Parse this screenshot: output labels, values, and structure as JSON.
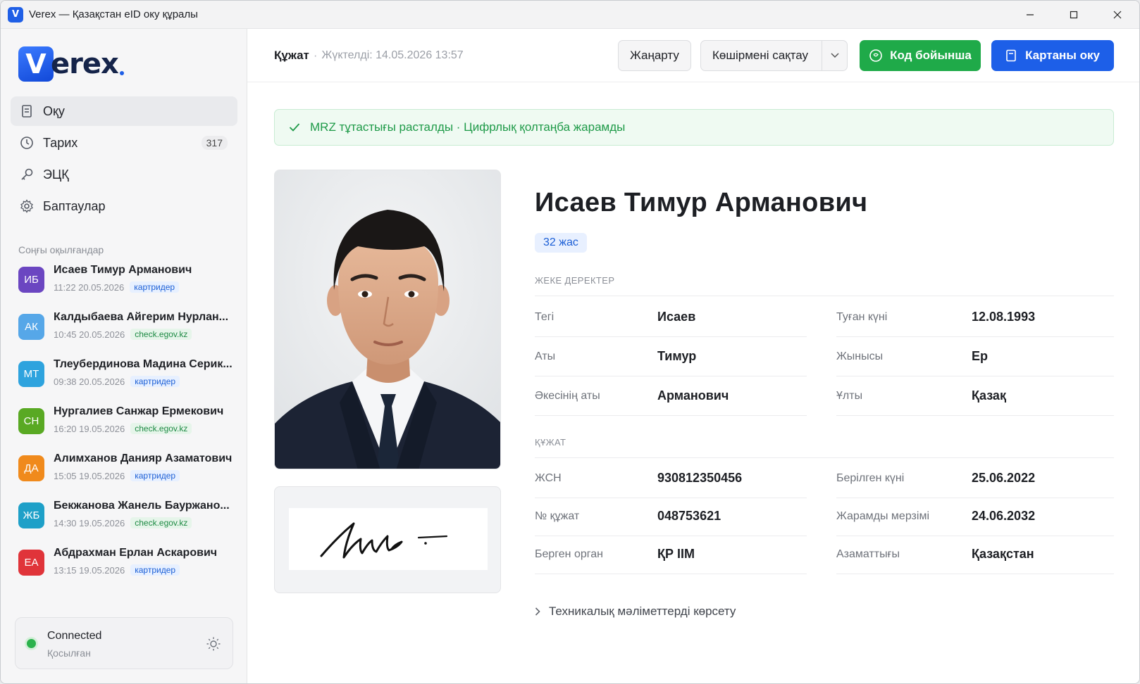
{
  "window": {
    "title": "Verex — Қазақстан eID оку құралы"
  },
  "logo": {
    "letter": "V",
    "text": "erex"
  },
  "nav": [
    {
      "label": "Оқу",
      "icon": "card-reader-icon",
      "count": ""
    },
    {
      "label": "Тарих",
      "icon": "clock-icon",
      "count": "317"
    },
    {
      "label": "ЭЦҚ",
      "icon": "key-icon",
      "count": ""
    },
    {
      "label": "Баптаулар",
      "icon": "gear-icon",
      "count": ""
    }
  ],
  "recent": {
    "title": "Соңғы оқылғандар",
    "items": [
      {
        "initials": "ИБ",
        "color": "#6b46c1",
        "name": "Исаев Тимур Арманович",
        "time": "11:22 20.05.2026",
        "source": "картридер",
        "source_kind": "blue"
      },
      {
        "initials": "АК",
        "color": "#56a7e8",
        "name": "Калдыбаева Айгерим Нурлан...",
        "time": "10:45 20.05.2026",
        "source": "check.egov.kz",
        "source_kind": "green"
      },
      {
        "initials": "МТ",
        "color": "#2ea3de",
        "name": "Тлеубердинова Мадина Серик...",
        "time": "09:38 20.05.2026",
        "source": "картридер",
        "source_kind": "blue"
      },
      {
        "initials": "СН",
        "color": "#59a923",
        "name": "Нургалиев Санжар Ермекович",
        "time": "16:20 19.05.2026",
        "source": "check.egov.kz",
        "source_kind": "green"
      },
      {
        "initials": "ДА",
        "color": "#f08a1c",
        "name": "Алимханов Данияр Азаматович",
        "time": "15:05 19.05.2026",
        "source": "картридер",
        "source_kind": "blue"
      },
      {
        "initials": "ЖБ",
        "color": "#1ea0c8",
        "name": "Бекжанова Жанель Бауржано...",
        "time": "14:30 19.05.2026",
        "source": "check.egov.kz",
        "source_kind": "green"
      },
      {
        "initials": "ЕА",
        "color": "#e0343a",
        "name": "Абдрахман Ерлан Аскарович",
        "time": "13:15 19.05.2026",
        "source": "картридер",
        "source_kind": "blue"
      }
    ]
  },
  "status": {
    "title": "Connected",
    "subtitle": "Қосылған"
  },
  "header": {
    "title": "Құжат",
    "subtitle": "Жүктелді: 14.05.2026 13:57",
    "refresh_label": "Жаңарту",
    "save_copy_label": "Көшірмені сақтау",
    "code_label": "Код бойынша",
    "read_card_label": "Картаны оку"
  },
  "alert": {
    "text": "MRZ тұтастығы расталды · Цифрлық қолтаңба жарамды"
  },
  "person": {
    "full_name": "Исаев Тимур Арманович",
    "age": "32 жас"
  },
  "personal": {
    "section": "ЖЕКЕ ДЕРЕКТЕР",
    "left": [
      {
        "label": "Тегі",
        "value": "Исаев"
      },
      {
        "label": "Аты",
        "value": "Тимур"
      },
      {
        "label": "Әкесінің аты",
        "value": "Арманович"
      }
    ],
    "right": [
      {
        "label": "Туған күні",
        "value": "12.08.1993"
      },
      {
        "label": "Жынысы",
        "value": "Ер"
      },
      {
        "label": "Ұлты",
        "value": "Қазақ"
      }
    ]
  },
  "document": {
    "section": "ҚҰЖАТ",
    "left": [
      {
        "label": "ЖСН",
        "value": "930812350456"
      },
      {
        "label": "№ құжат",
        "value": "048753621"
      },
      {
        "label": "Берген орган",
        "value": "ҚР IIM"
      }
    ],
    "right": [
      {
        "label": "Берілген күні",
        "value": "25.06.2022"
      },
      {
        "label": "Жарамды мерзімі",
        "value": "24.06.2032"
      },
      {
        "label": "Азаматтығы",
        "value": "Қазақстан"
      }
    ]
  },
  "tech": {
    "label": "Техникалық мәліметтерді көрсету"
  }
}
